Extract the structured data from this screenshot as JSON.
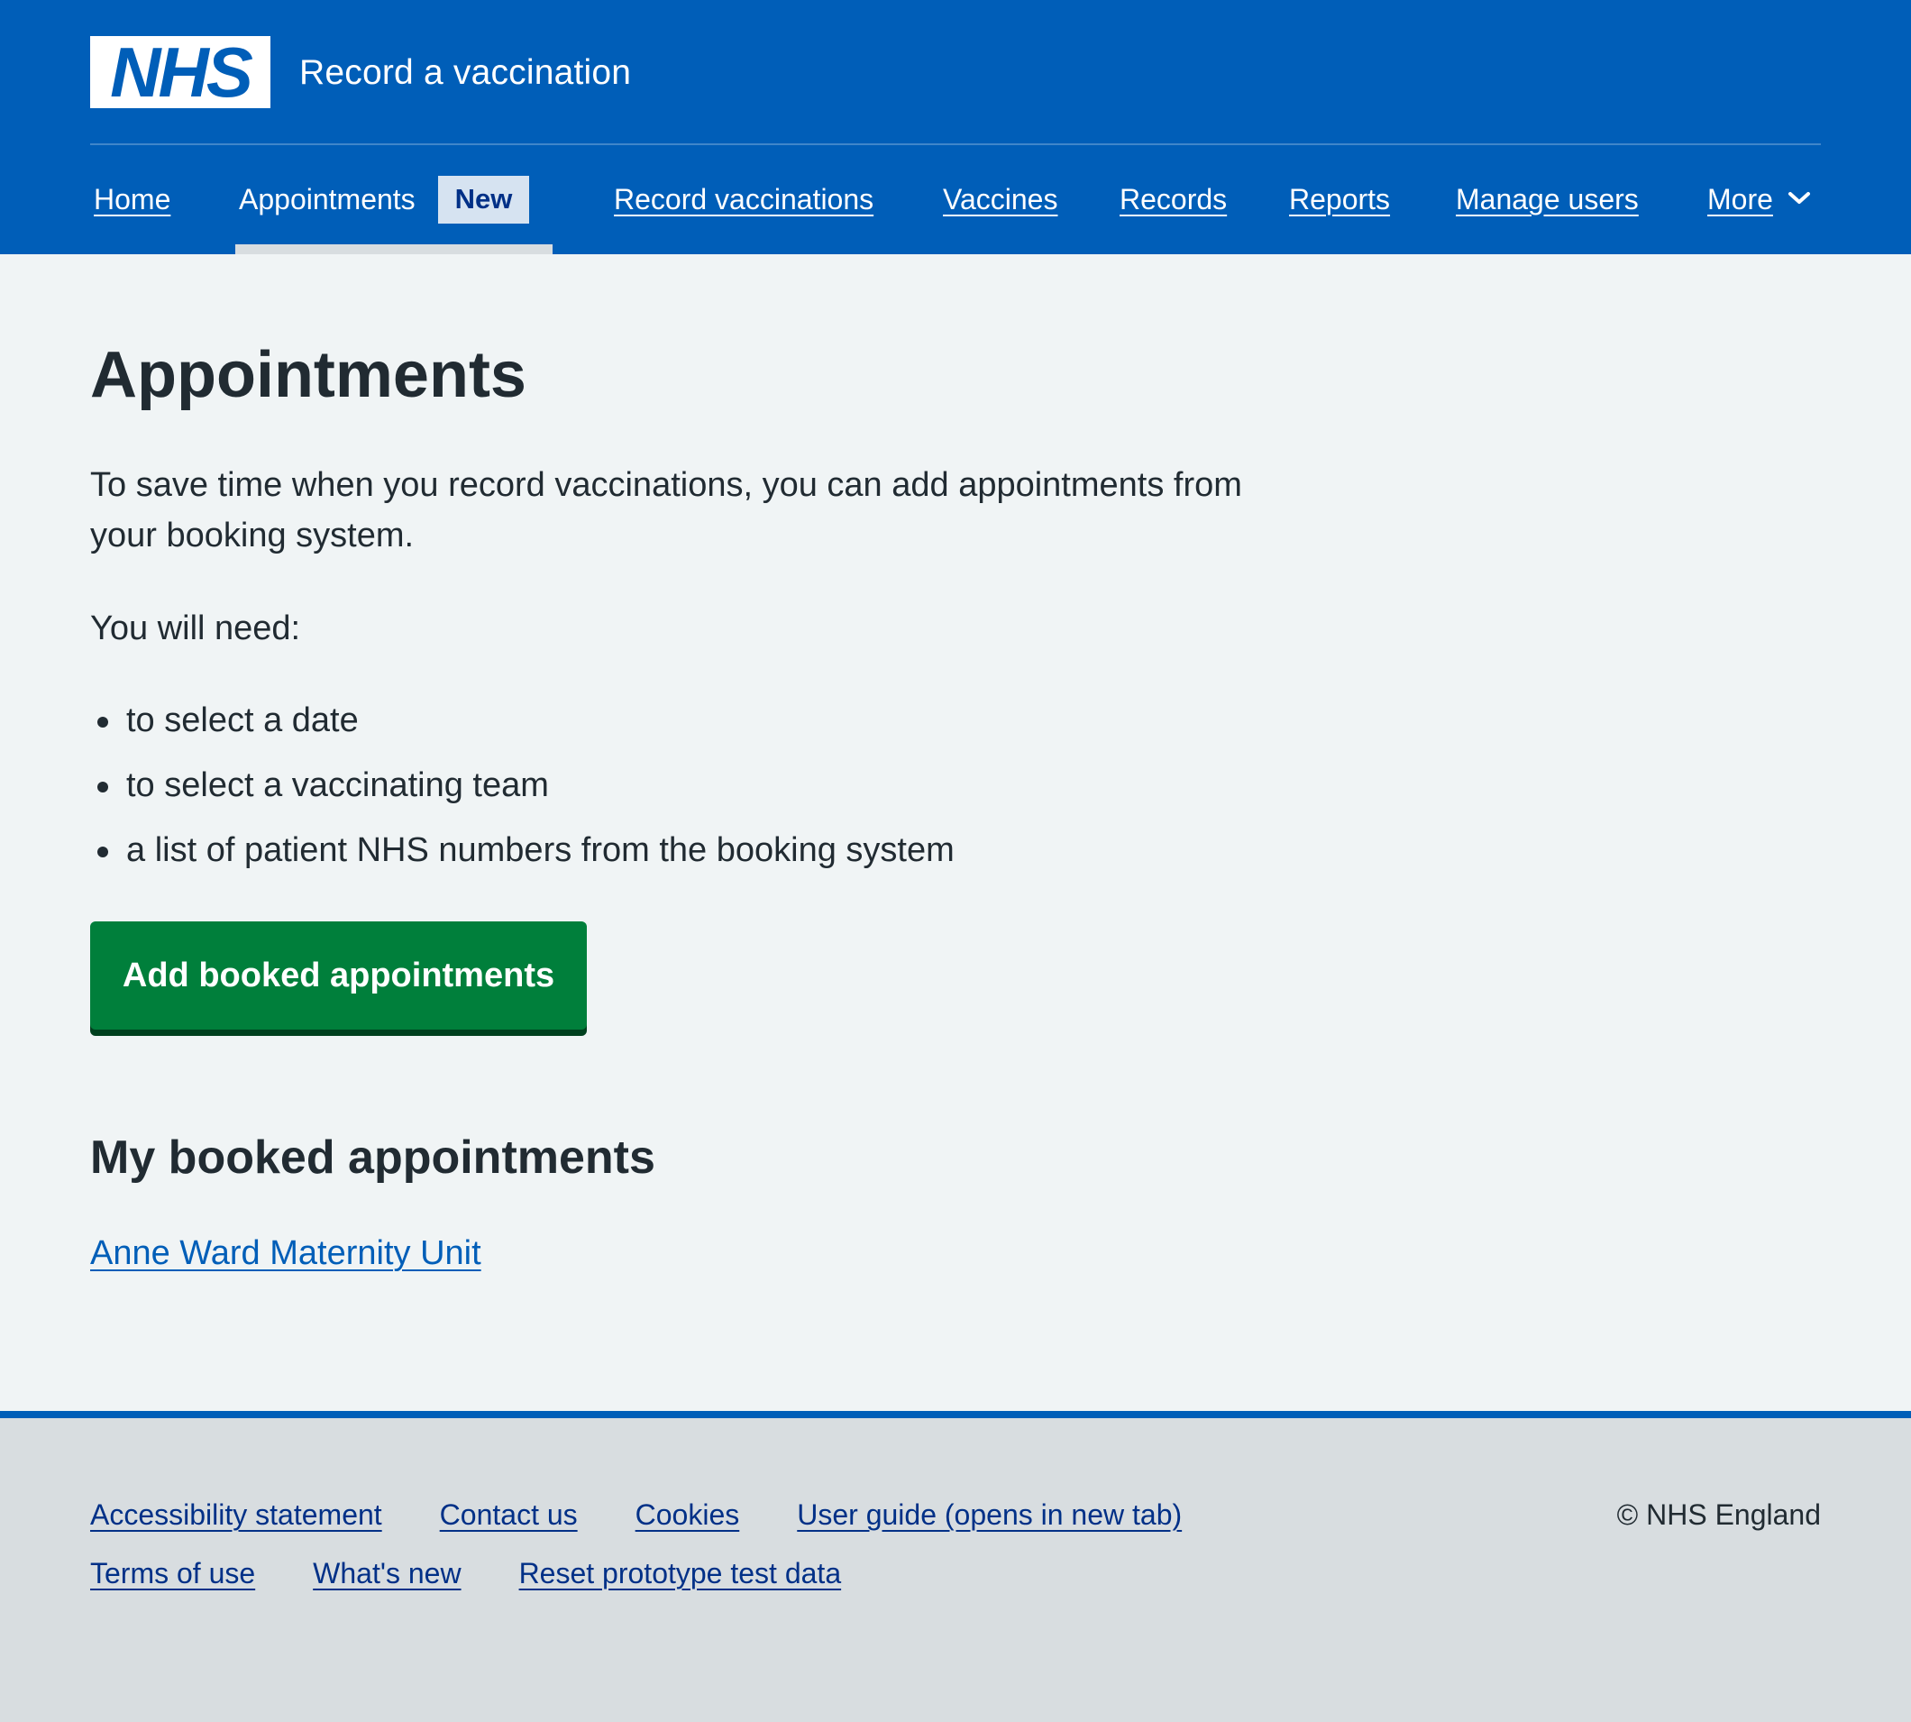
{
  "header": {
    "logo_text": "NHS",
    "service_name": "Record a vaccination",
    "brand_color": "#005eb8"
  },
  "nav": {
    "items": [
      {
        "label": "Home"
      },
      {
        "label": "Appointments",
        "tag": "New",
        "current": true
      },
      {
        "label": "Record vaccinations"
      },
      {
        "label": "Vaccines"
      },
      {
        "label": "Records"
      },
      {
        "label": "Reports"
      },
      {
        "label": "Manage users"
      },
      {
        "label": "More",
        "icon": "chevron-down-icon"
      }
    ]
  },
  "main": {
    "title": "Appointments",
    "intro": "To save time when you record vaccinations, you can add appointments from your booking system.",
    "need_heading": "You will need:",
    "need_items": [
      "to select a date",
      "to select a vaccinating team",
      "a list of patient NHS numbers from the booking system"
    ],
    "button_label": "Add booked appointments",
    "button_color": "#007f3b",
    "section_heading": "My booked appointments",
    "appointment_link": "Anne Ward Maternity Unit"
  },
  "footer": {
    "row1": [
      "Accessibility statement",
      "Contact us",
      "Cookies",
      "User guide (opens in new tab)"
    ],
    "row2": [
      "Terms of use",
      "What's new",
      "Reset prototype test data"
    ],
    "copyright": "© NHS England"
  }
}
